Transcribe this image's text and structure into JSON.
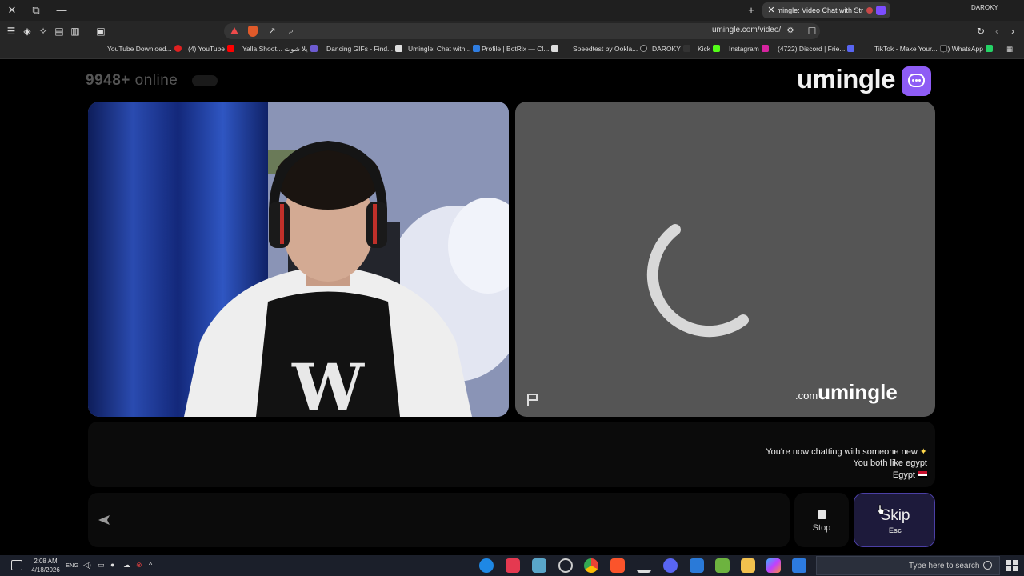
{
  "browser": {
    "tab_title": "Umingle: Video Chat with Str...",
    "profile_name": "DAROKY",
    "url": "umingle.com/video/"
  },
  "bookmarks": [
    {
      "label": "(2) WhatsApp",
      "color": "#25d366"
    },
    {
      "label": "TikTok - Make Your...",
      "color": "#111111"
    },
    {
      "label": "(4722) Discord | Frie...",
      "color": "#5865f2"
    },
    {
      "label": "Instagram",
      "color": "#d6249f"
    },
    {
      "label": "Kick",
      "color": "#53fc18"
    },
    {
      "label": "DAROKY",
      "color": "#222222"
    },
    {
      "label": "Speedtest by Ookla...",
      "color": "#1a1a1a"
    },
    {
      "label": "Profile | BotRix — Cl...",
      "color": "#222222"
    },
    {
      "label": "Umingle: Chat with...",
      "color": "#2f7de1"
    },
    {
      "label": "Dancing GIFs - Find...",
      "color": "#dddddd"
    },
    {
      "label": "Yalla Shoot... يلا شوت",
      "color": "#6d5bd0"
    },
    {
      "label": "(4) YouTube",
      "color": "#ff0000"
    },
    {
      "label": "YouTube Downloed...",
      "color": "#e02020"
    }
  ],
  "site": {
    "online_count": "9948+",
    "online_label": "online",
    "logo_text": "umingle",
    "watermark": "umingle",
    "watermark_suffix": ".com"
  },
  "chat": {
    "messages": [
      {
        "text": "You're now chatting with someone new",
        "icon": "sparkle-icon"
      },
      {
        "text": "You both like egypt",
        "icon": ""
      },
      {
        "text": "Egypt",
        "icon": "egypt-flag-icon"
      }
    ],
    "input_placeholder": ""
  },
  "controls": {
    "stop_label": "Stop",
    "skip_label": "Skip",
    "skip_key": "Esc"
  },
  "taskbar": {
    "search_placeholder": "Type here to search",
    "time": "2:08 AM",
    "date": "4/18/2026",
    "language": "ENG"
  },
  "colors": {
    "brand": "#8e5cf5",
    "skip_bg": "#1d1a3b",
    "skip_border": "#4b3fa5"
  }
}
